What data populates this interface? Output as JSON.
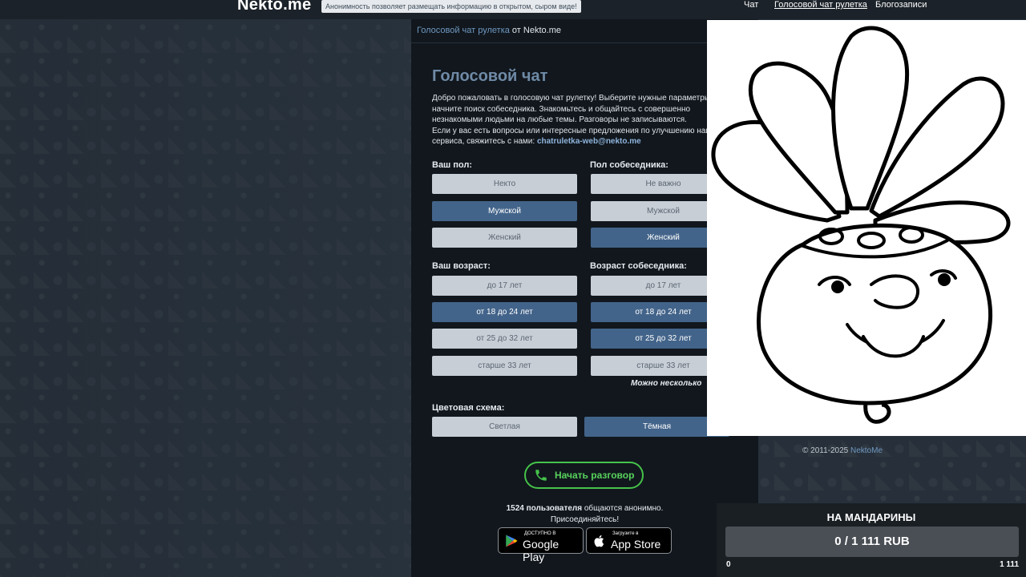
{
  "header": {
    "logo": "Nekto.me",
    "slogan": "Анонимность позволяет размещать информацию в открытом, сыром виде!",
    "nav": [
      "Чат",
      "Голосовой чат рулетка",
      "Блогозаписи"
    ]
  },
  "breadcrumb": {
    "link": "Голосовой чат рулетка",
    "suffix": " от Nekto.me"
  },
  "main": {
    "title": "Голосовой чат",
    "intro": [
      "Добро пожаловать в голосовую чат рулетку! Выберите нужные параметры",
      "начните поиск собеседника. Знакомьтесь и общайтесь с совершенно",
      "незнакомыми людьми на любые темы. Разговоры не записываются.",
      "Если у вас есть вопросы или интересные предложения по улучшению наш",
      "сервиса, свяжитесь с нами:"
    ],
    "email": "chatruletka-web@nekto.me"
  },
  "form": {
    "your_gender": {
      "label": "Ваш пол:",
      "options": [
        "Некто",
        "Мужской",
        "Женский"
      ],
      "selected": "Мужской"
    },
    "partner_gender": {
      "label": "Пол собеседника:",
      "options": [
        "Не важно",
        "Мужской",
        "Женский"
      ],
      "selected": "Женский"
    },
    "your_age": {
      "label": "Ваш возраст:",
      "options": [
        "до 17 лет",
        "от 18 до 24 лет",
        "от 25 до 32 лет",
        "старше 33 лет"
      ],
      "selected": "от 18 до 24 лет"
    },
    "partner_age": {
      "label": "Возраст собеседника:",
      "options": [
        "до 17 лет",
        "от 18 до 24 лет",
        "от 25 до 32 лет",
        "старше 33 лет"
      ],
      "selected": [
        "от 18 до 24 лет",
        "от 25 до 32 лет"
      ],
      "hint": "Можно несколько"
    },
    "color_scheme": {
      "label": "Цветовая схема:",
      "options": [
        "Светлая",
        "Тёмная"
      ],
      "selected": "Тёмная"
    }
  },
  "start_button": "Начать разговор",
  "online": {
    "count": "1524 пользователя",
    "text": " общаются анонимно.",
    "line2": "Присоединяйтесь!"
  },
  "stores": {
    "google": {
      "small": "ДОСТУПНО В",
      "big": "Google Play"
    },
    "apple": {
      "small": "Загрузите в",
      "big": "App Store"
    }
  },
  "footer": {
    "copyright": "© 2011-2025 ",
    "link": "NektoMe"
  },
  "donation": {
    "title": "НА МАНДАРИНЫ",
    "amount": "0 / 1 111 RUB",
    "min": "0",
    "max": "1 111",
    "progress": 0
  },
  "colors": {
    "accent": "#43648a",
    "start_green": "#46c24a",
    "panel_bg": "#11171d"
  }
}
